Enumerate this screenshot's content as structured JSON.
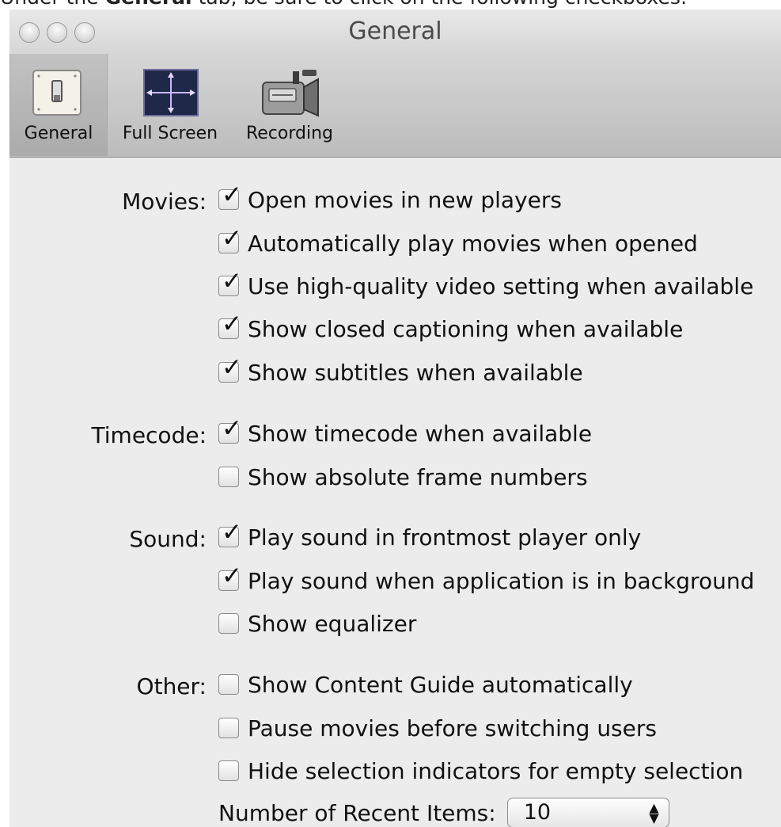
{
  "caption": {
    "prefix": "Under the",
    "tab_name": "General",
    "suffix": "tab, be sure to click on the following checkboxes:"
  },
  "window": {
    "title": "General"
  },
  "toolbar": {
    "items": [
      {
        "label": "General",
        "icon": "switch-icon",
        "selected": true
      },
      {
        "label": "Full Screen",
        "icon": "fullscreen-arrows-icon",
        "selected": false
      },
      {
        "label": "Recording",
        "icon": "camcorder-icon",
        "selected": false
      }
    ]
  },
  "sections": {
    "movies": {
      "label": "Movies:",
      "options": [
        {
          "label": "Open movies in new players",
          "checked": true
        },
        {
          "label": "Automatically play movies when opened",
          "checked": true
        },
        {
          "label": "Use high-quality video setting when available",
          "checked": true
        },
        {
          "label": "Show closed captioning when available",
          "checked": true
        },
        {
          "label": "Show subtitles when available",
          "checked": true
        }
      ]
    },
    "timecode": {
      "label": "Timecode:",
      "options": [
        {
          "label": "Show timecode when available",
          "checked": true
        },
        {
          "label": "Show absolute frame numbers",
          "checked": false
        }
      ]
    },
    "sound": {
      "label": "Sound:",
      "options": [
        {
          "label": "Play sound in frontmost player only",
          "checked": true
        },
        {
          "label": "Play sound when application is in background",
          "checked": true
        },
        {
          "label": "Show equalizer",
          "checked": false
        }
      ]
    },
    "other": {
      "label": "Other:",
      "options": [
        {
          "label": "Show Content Guide automatically",
          "checked": false
        },
        {
          "label": "Pause movies before switching users",
          "checked": false
        },
        {
          "label": "Hide selection indicators for empty selection",
          "checked": false
        }
      ]
    }
  },
  "recent_items": {
    "label": "Number of Recent Items:",
    "value": "10"
  },
  "colors": {
    "window_bg": "#ececec",
    "toolbar_bg": "#c9c9c9",
    "check": "#111111"
  }
}
